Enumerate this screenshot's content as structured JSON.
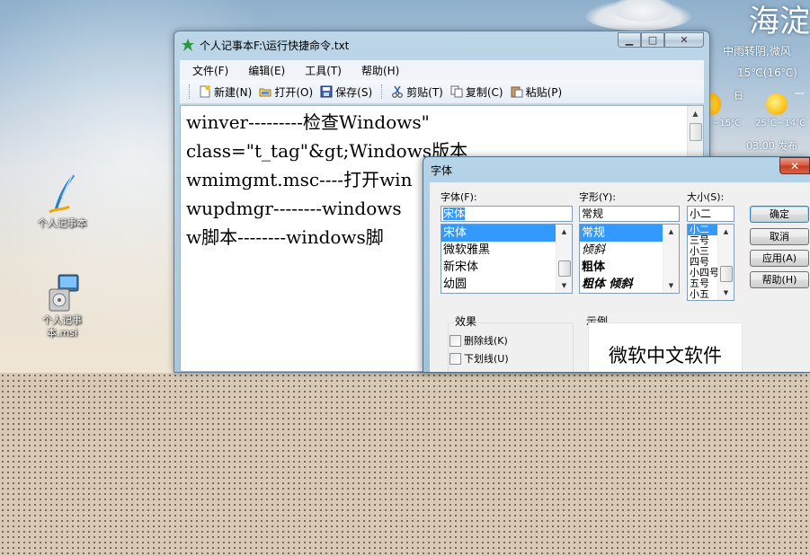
{
  "desktop": {
    "icons": [
      {
        "label": "个人记事本"
      },
      {
        "label": "个人记事本.msi"
      }
    ]
  },
  "weather": {
    "city": "海淀",
    "condition": "中雨转阴,微风",
    "temperature": "15℃(16℃)",
    "day_label": "日",
    "dash": "一",
    "low_left": "~15℃",
    "forecast_range": "25℃~14℃",
    "published": "03:00 发布"
  },
  "notepad": {
    "title": "个人记事本F:\\运行快捷命令.txt",
    "caption": {
      "min": "▁",
      "max": "□",
      "close": "✕"
    },
    "menu": [
      "文件(F)",
      "编辑(E)",
      "工具(T)",
      "帮助(H)"
    ],
    "toolbar": {
      "new": "新建(N)",
      "open": "打开(O)",
      "save": "保存(S)",
      "cut": "剪贴(T)",
      "copy": "复制(C)",
      "paste": "粘贴(P)"
    },
    "lines": [
      "winver---------检查Windows\"",
      "class=\"t_tag\"&gt;Windows版本",
      "",
      "wmimgmt.msc----打开win",
      "",
      "wupdmgr--------windows",
      "",
      "w脚本--------windows脚"
    ]
  },
  "font_dialog": {
    "title": "字体",
    "close": "✕",
    "font_label": "字体(F):",
    "font_value": "宋体",
    "font_list": [
      "宋体",
      "微软雅黑",
      "新宋体",
      "幼圆"
    ],
    "style_label": "字形(Y):",
    "style_value": "常规",
    "style_list": [
      "常规",
      "倾斜",
      "粗体",
      "粗体 倾斜"
    ],
    "size_label": "大小(S):",
    "size_value": "小二",
    "size_list": [
      "小二",
      "三号",
      "小三",
      "四号",
      "小四号",
      "五号",
      "小五"
    ],
    "buttons": {
      "ok": "确定",
      "cancel": "取消",
      "apply": "应用(A)",
      "help": "帮助(H)"
    },
    "effects_title": "效果",
    "strike_label": "删除线(K)",
    "underline_label": "下划线(U)",
    "sample_title": "示例",
    "sample_text": "微软中文软件"
  }
}
